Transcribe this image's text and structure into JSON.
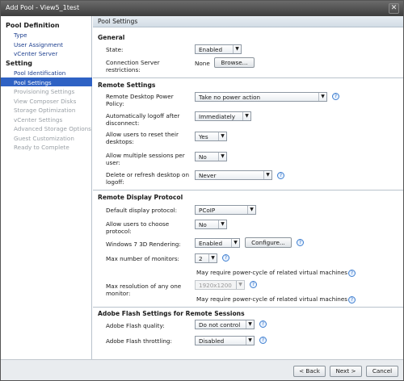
{
  "window": {
    "title": "Add Pool - View5_1test",
    "close_glyph": "✕"
  },
  "sidebar": {
    "headers": [
      "Pool Definition",
      "Setting"
    ],
    "items": [
      "Type",
      "User Assignment",
      "vCenter Server",
      "Pool Identification",
      "Pool Settings",
      "Provisioning Settings",
      "View Composer Disks",
      "Storage Optimization",
      "vCenter Settings",
      "Advanced Storage Options",
      "Guest Customization",
      "Ready to Complete"
    ]
  },
  "panel": {
    "title": "Pool Settings"
  },
  "general": {
    "heading": "General",
    "state_label": "State:",
    "state_value": "Enabled",
    "cs_label": "Connection Server restrictions:",
    "cs_value": "None",
    "browse": "Browse..."
  },
  "remote": {
    "heading": "Remote Settings",
    "power_label": "Remote Desktop Power Policy:",
    "power_value": "Take no power action",
    "logoff_label": "Automatically logoff after disconnect:",
    "logoff_value": "Immediately",
    "reset_label": "Allow users to reset their desktops:",
    "reset_value": "Yes",
    "multi_label": "Allow multiple sessions per user:",
    "multi_value": "No",
    "delete_label": "Delete or refresh desktop on logoff:",
    "delete_value": "Never"
  },
  "display": {
    "heading": "Remote Display Protocol",
    "default_label": "Default display protocol:",
    "default_value": "PCoIP",
    "choose_label": "Allow users to choose protocol:",
    "choose_value": "No",
    "w7_label": "Windows 7 3D Rendering:",
    "w7_value": "Enabled",
    "configure": "Configure...",
    "monitors_label": "Max number of monitors:",
    "monitors_value": "2",
    "note": "May require power-cycle of related virtual machines",
    "res_label": "Max resolution of any one monitor:",
    "res_value": "1920x1200"
  },
  "flash": {
    "heading": "Adobe Flash Settings for Remote Sessions",
    "quality_label": "Adobe Flash quality:",
    "quality_value": "Do not control",
    "throttle_label": "Adobe Flash throttling:",
    "throttle_value": "Disabled"
  },
  "footer": {
    "back": "< Back",
    "next": "Next >",
    "cancel": "Cancel"
  },
  "icons": {
    "dropdown": "chevron-down-icon",
    "help": "help-icon",
    "close": "close-icon"
  },
  "glyphs": {
    "arrow": "▼",
    "help": "?"
  }
}
